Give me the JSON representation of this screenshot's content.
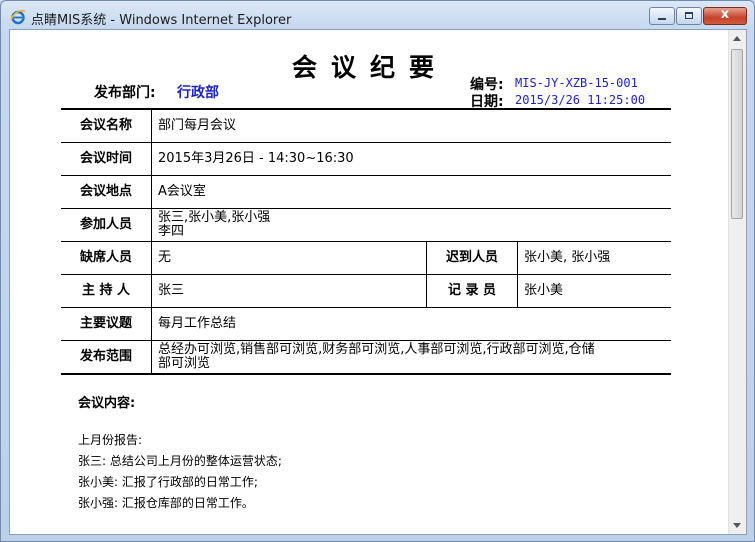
{
  "window": {
    "title": "点睛MIS系统 - Windows Internet Explorer",
    "close_glyph": "x"
  },
  "doc": {
    "title": "会议纪要",
    "dept_label": "发布部门:",
    "dept_value": "行政部",
    "no_label": "编号:",
    "no_value": "MIS-JY-XZB-15-001",
    "date_label": "日期:",
    "date_value": "2015/3/26 11:25:00"
  },
  "table": {
    "name_label": "会议名称",
    "name_value": "部门每月会议",
    "time_label": "会议时间",
    "time_value": "2015年3月26日 - 14:30~16:30",
    "place_label": "会议地点",
    "place_value": "A会议室",
    "attend_label": "参加人员",
    "attend_line1": "张三,张小美,张小强",
    "attend_line2": "李四",
    "absent_label": "缺席人员",
    "absent_value": "无",
    "late_label": "迟到人员",
    "late_value": "张小美, 张小强",
    "host_label": "主 持 人",
    "host_value": "张三",
    "recorder_label": "记 录 员",
    "recorder_value": "张小美",
    "topic_label": "主要议题",
    "topic_value": "每月工作总结",
    "scope_label": "发布范围",
    "scope_line1": "总经办可浏览,销售部可浏览,财务部可浏览,人事部可浏览,行政部可浏览,仓储",
    "scope_line2": "部可浏览"
  },
  "content": {
    "label": "会议内容:",
    "lines": [
      "上月份报告:",
      "张三: 总结公司上月份的整体运营状态;",
      "张小美: 汇报了行政部的日常工作;",
      "张小强: 汇报仓库部的日常工作。"
    ]
  }
}
